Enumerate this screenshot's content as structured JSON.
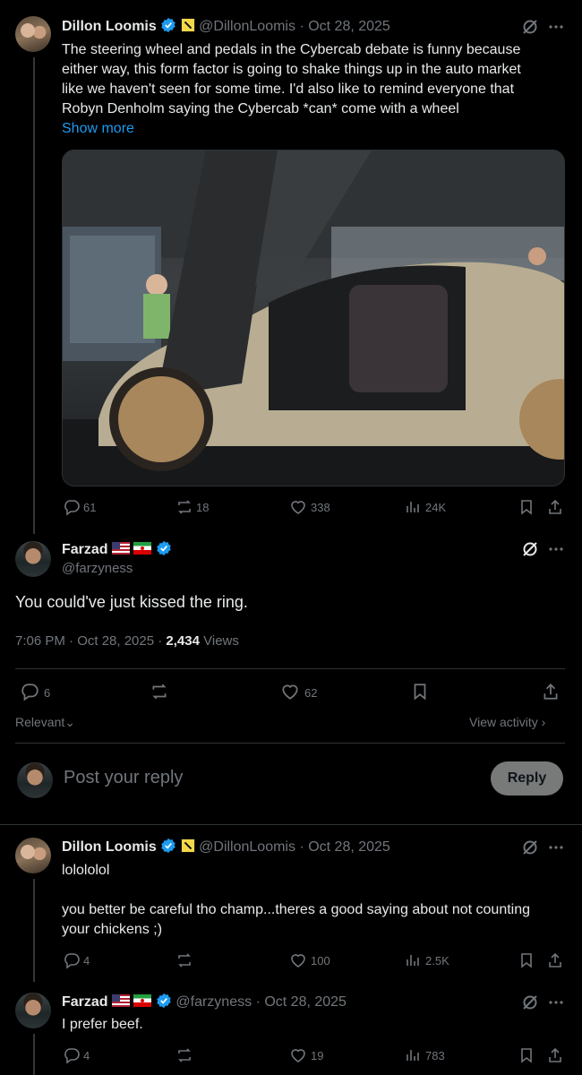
{
  "posts": [
    {
      "author": "Dillon Loomis",
      "handle": "@DillonLoomis",
      "date": "· Oct 28, 2025",
      "lines": [
        "The steering wheel and pedals in the Cybercab debate is funny because",
        "either way, this form factor is going to shake things up in the auto market",
        "like we haven't seen for some time. I'd also like to remind everyone that",
        "Robyn Denholm saying the Cybercab *can* come with a wheel"
      ],
      "show_more": "Show more",
      "replies": "61",
      "reposts": "18",
      "likes": "338",
      "views": "24K"
    },
    {
      "author": "Dillon Loomis",
      "handle": "@DillonLoomis",
      "date": "· Oct 28, 2025",
      "line1": "lolololol",
      "line2": "you better be careful tho champ...theres a good saying about not counting",
      "line3": "your chickens ;)",
      "replies": "4",
      "reposts": "",
      "likes": "100",
      "views": "2.5K"
    },
    {
      "author": "Farzad",
      "handle": "@farzyness",
      "date": "· Oct 28, 2025",
      "line1": "I prefer beef.",
      "replies": "4",
      "reposts": "",
      "likes": "19",
      "views": "783"
    }
  ],
  "main": {
    "author": "Farzad",
    "handle": "@farzyness",
    "text": "You could've just kissed the ring.",
    "time": "7:06 PM · Oct 28, 2025 · ",
    "views_count": "2,434",
    "views_label": " Views",
    "replies": "6",
    "likes": "62"
  },
  "sort": {
    "relevant": "Relevant",
    "view_activity": "View activity"
  },
  "composer": {
    "placeholder": "Post your reply",
    "reply_button": "Reply"
  },
  "colors": {
    "accent": "#1d9bf0",
    "muted": "#71767b",
    "verified": "#1d9bf0"
  }
}
